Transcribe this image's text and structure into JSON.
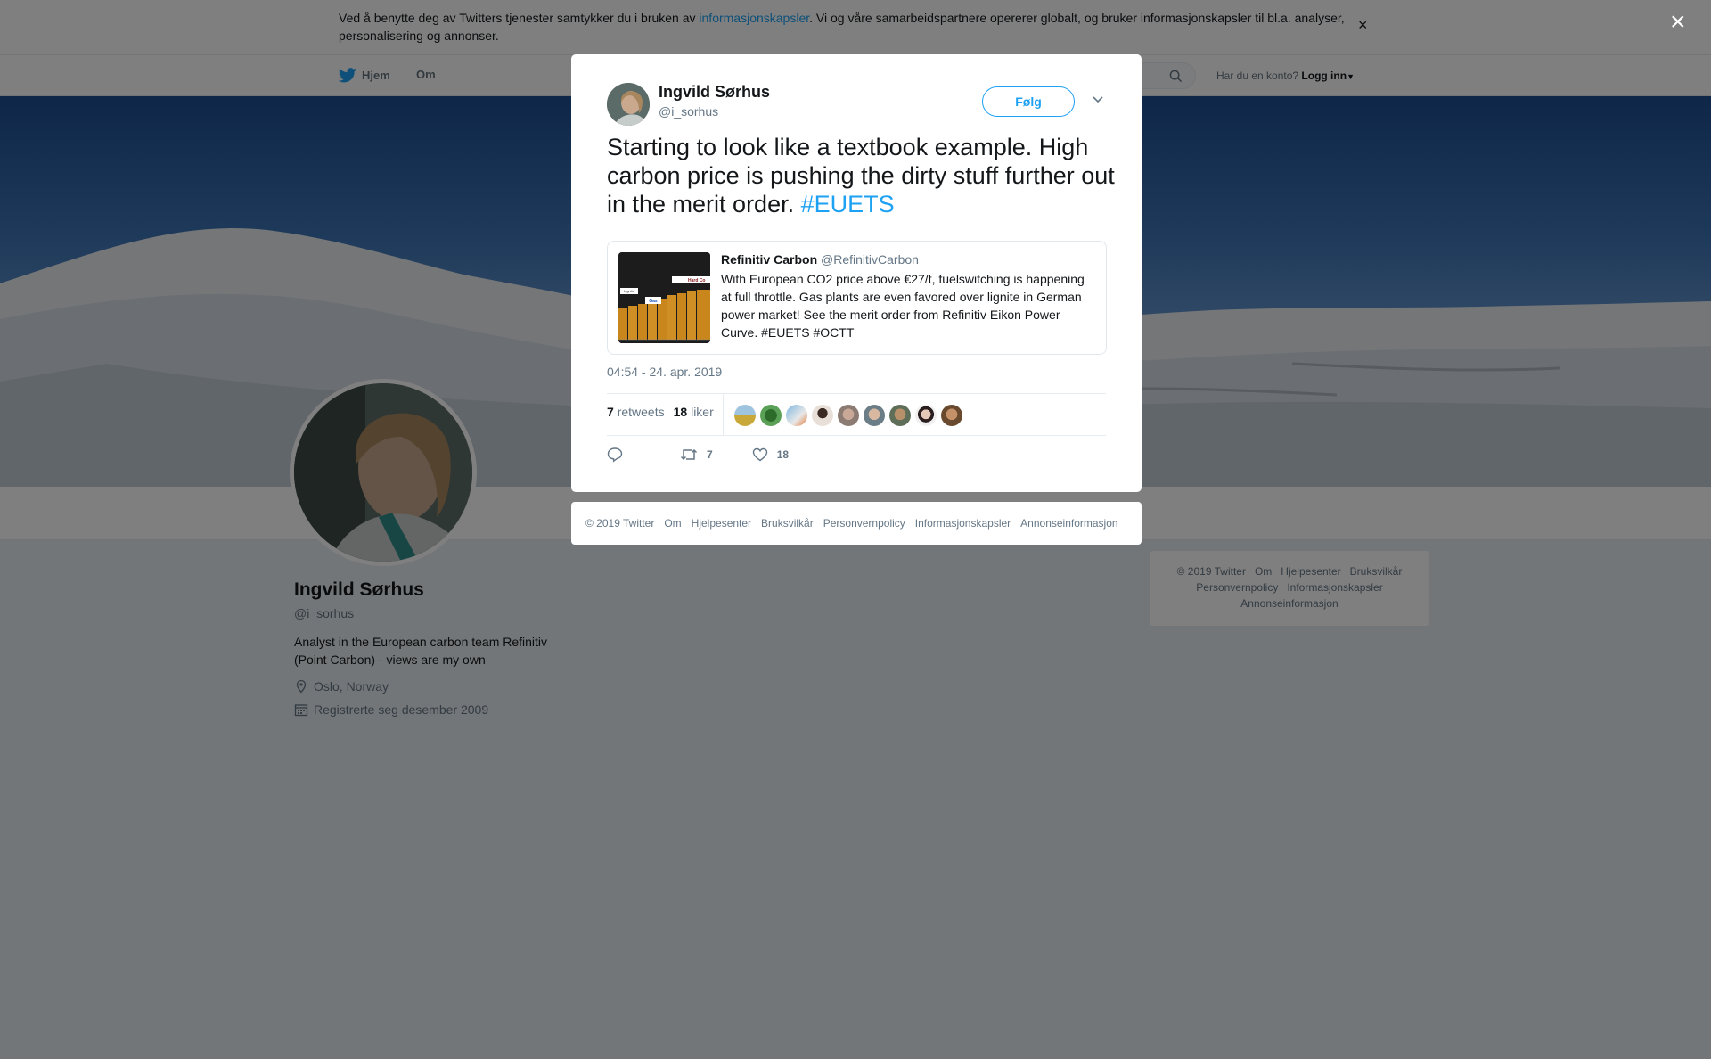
{
  "cookie_bar": {
    "text_before": "Ved å benytte deg av Twitters tjenester samtykker du i bruken av ",
    "link": "informasjonskapsler",
    "text_after": ". Vi og våre samarbeidspartnere opererer globalt, og bruker informasjonskapsler til bl.a. analyser, personalisering og annonser.",
    "close": "×"
  },
  "nav": {
    "home": "Hjem",
    "about": "Om",
    "account_prompt": "Har du en konto?",
    "login": "Logg inn"
  },
  "profile": {
    "name": "Ingvild Sørhus",
    "handle": "@i_sorhus",
    "bio": "Analyst in the European carbon team Refinitiv (Point Carbon) - views are my own",
    "location": "Oslo, Norway",
    "joined": "Registrerte seg desember 2009"
  },
  "side_footer": {
    "row1": [
      "© 2019 Twitter",
      "Om",
      "Hjelpesenter",
      "Bruksvilkår"
    ],
    "row2": [
      "Personvernpolicy",
      "Informasjonskapsler"
    ],
    "row3": [
      "Annonseinformasjon"
    ]
  },
  "overlay": {
    "close": "×"
  },
  "tweet": {
    "author_name": "Ingvild Sørhus",
    "author_handle": "@i_sorhus",
    "follow_label": "Følg",
    "text": "Starting to look like a textbook example. High carbon price is pushing the dirty stuff further out in the merit order. ",
    "hashtag": "#EUETS",
    "quoted": {
      "author_name": "Refinitiv Carbon",
      "author_handle": "@RefinitivCarbon",
      "text": "With European CO2 price above €27/t, fuelswitching is happening at full throttle. Gas plants are even favored over lignite in German power market! See the merit order from Refinitiv Eikon Power Curve.  #EUETS #OCTT",
      "thumb_labels": [
        "Gas",
        "Hard Co",
        "Lignite"
      ]
    },
    "timestamp": "04:54 - 24. apr. 2019",
    "retweets_count": "7",
    "retweets_label": "retweets",
    "likes_count": "18",
    "likes_label": "liker",
    "action_retweet_count": "7",
    "action_like_count": "18"
  },
  "modal_footer": {
    "links": [
      "© 2019 Twitter",
      "Om",
      "Hjelpesenter",
      "Bruksvilkår",
      "Personvernpolicy",
      "Informasjonskapsler",
      "Annonseinformasjon"
    ]
  },
  "colors": {
    "accent": "#1da1f2",
    "secondary_text": "#657786",
    "overlay": "rgba(0,0,0,0.5)"
  }
}
